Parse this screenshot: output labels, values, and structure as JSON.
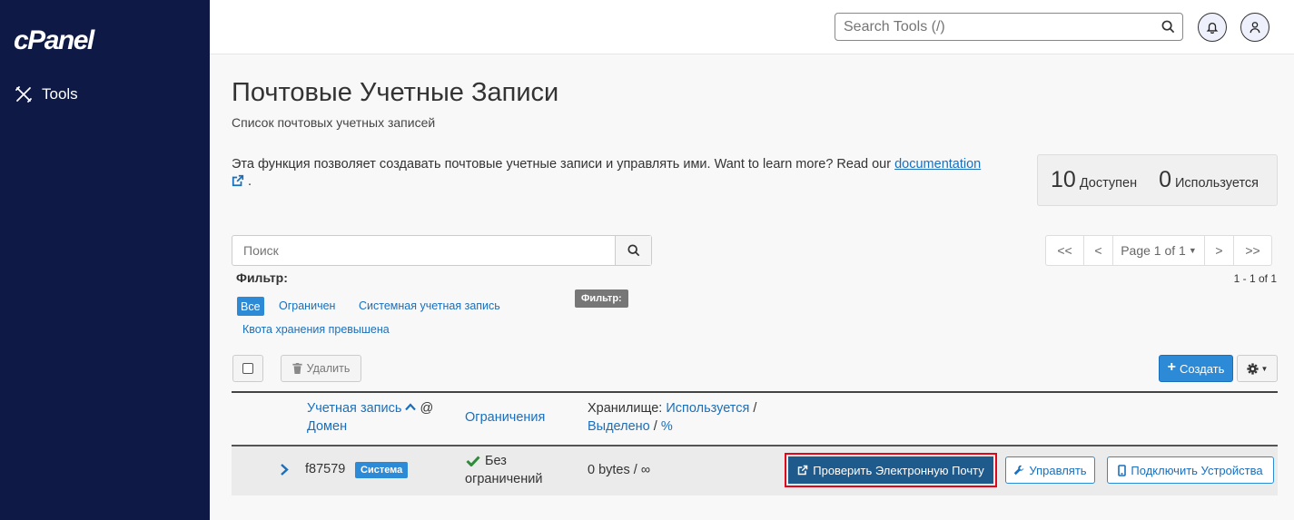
{
  "sidebar": {
    "logo": "cPanel",
    "tools_label": "Tools"
  },
  "header": {
    "search_placeholder": "Search Tools (/)"
  },
  "page": {
    "title": "Почтовые Учетные Записи",
    "subtitle": "Список почтовых учетных записей",
    "description": "Эта функция позволяет создавать почтовые учетные записи и управлять ими. Want to learn more? Read our ",
    "doc_link": "documentation",
    "doc_suffix": " ."
  },
  "stats": {
    "available_num": "10",
    "available_label": "Доступен",
    "used_num": "0",
    "used_label": "Используется"
  },
  "search": {
    "placeholder": "Поиск"
  },
  "pager": {
    "first": "<<",
    "prev": "<",
    "page": "Page 1 of 1",
    "next": ">",
    "last": ">>",
    "range": "1 - 1 of 1"
  },
  "filter": {
    "label": "Фильтр:",
    "tooltip": "Фильтр:",
    "all": "Все",
    "restricted": "Ограничен",
    "system": "Системная учетная запись",
    "quota": "Квота хранения превышена"
  },
  "actions": {
    "delete": "Удалить",
    "create": "Создать"
  },
  "table": {
    "col_account": "Учетная запись",
    "col_at": "@",
    "col_domain": "Домен",
    "col_limits": "Ограничения",
    "col_storage_prefix": "Хранилище:",
    "col_storage_used": "Используется",
    "col_slash": "/",
    "col_storage_alloc": "Выделено",
    "col_pct": "%",
    "rows": [
      {
        "account": "f87579",
        "badge": "Система",
        "limits_line1": "Без",
        "limits_line2": "ограничений",
        "storage": "0 bytes / ∞",
        "btn_check": "Проверить Электронную Почту",
        "btn_manage": "Управлять",
        "btn_devices": "Подключить Устройства"
      }
    ]
  },
  "colors": {
    "sidebar": "#0e1a45",
    "accent": "#2d8ad6",
    "highlight": "#e0061b"
  }
}
